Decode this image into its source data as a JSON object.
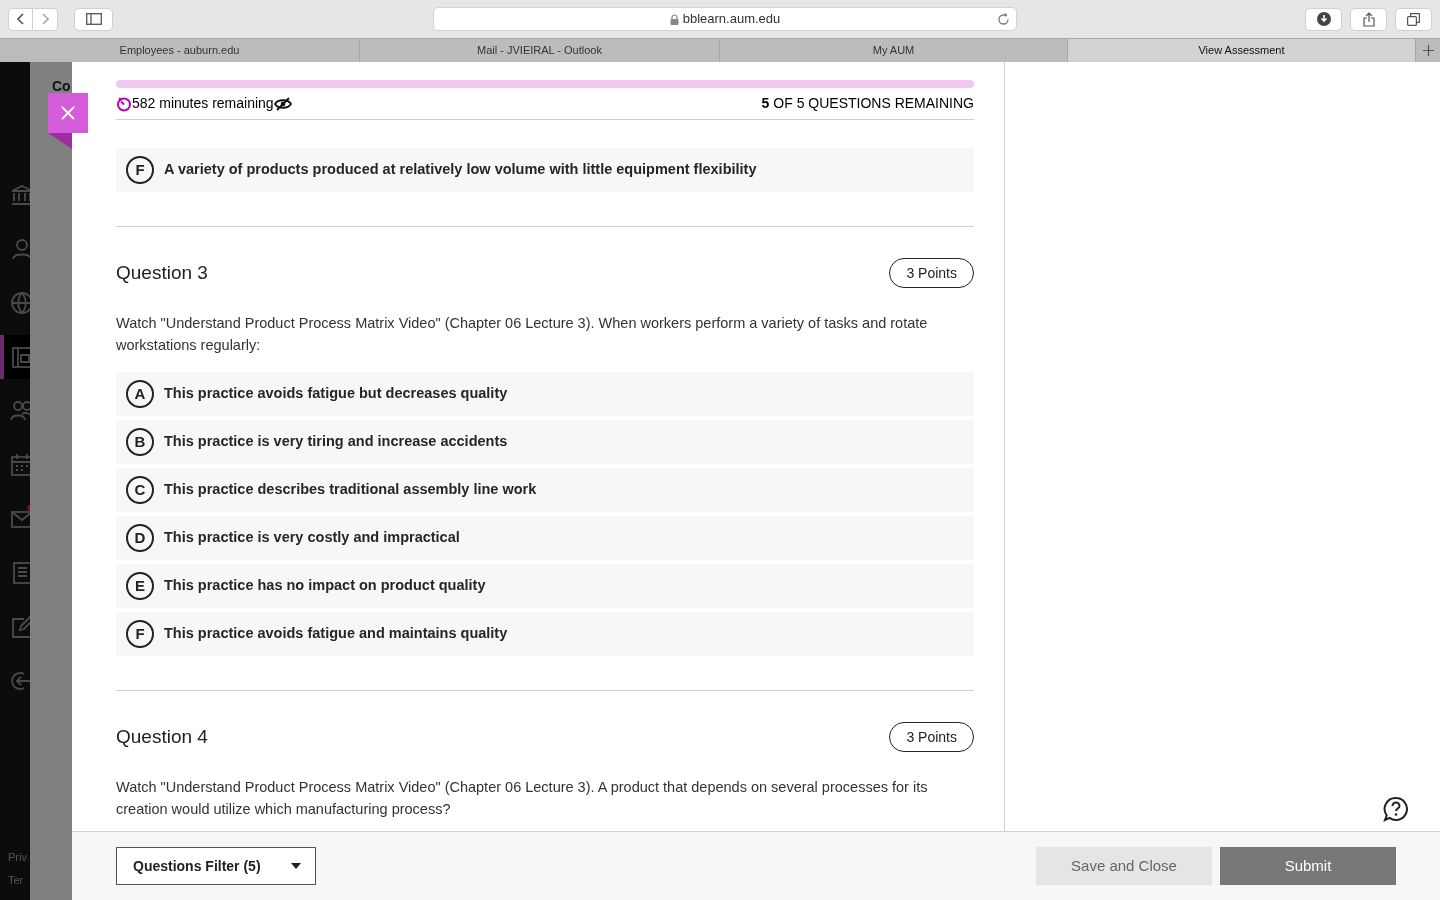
{
  "browser": {
    "url": "bblearn.aum.edu",
    "tabs": [
      {
        "label": "Employees - auburn.edu",
        "selected": false
      },
      {
        "label": "Mail - JVIEIRAL - Outlook",
        "selected": false
      },
      {
        "label": "My AUM",
        "selected": false
      },
      {
        "label": "View Assessment",
        "selected": true
      }
    ]
  },
  "background": {
    "course_fragment": "Co",
    "footer_fragments": [
      "Priv",
      "Ter"
    ]
  },
  "sidebar": {
    "items": [
      {
        "kind": "institution",
        "selected": false,
        "unread": false
      },
      {
        "kind": "profile",
        "selected": false,
        "unread": false
      },
      {
        "kind": "globe",
        "selected": false,
        "unread": false
      },
      {
        "kind": "courses",
        "selected": true,
        "unread": false
      },
      {
        "kind": "people",
        "selected": false,
        "unread": false
      },
      {
        "kind": "calendar",
        "selected": false,
        "unread": false
      },
      {
        "kind": "messages",
        "selected": false,
        "unread": true
      },
      {
        "kind": "grades",
        "selected": false,
        "unread": false
      },
      {
        "kind": "tools",
        "selected": false,
        "unread": false
      },
      {
        "kind": "signout",
        "selected": false,
        "unread": false
      }
    ]
  },
  "timer": {
    "text": "582 minutes remaining"
  },
  "questions_remaining": "**5** OF 5 QUESTIONS REMAINING",
  "questions": [
    {
      "options": [
        {
          "letter": "F",
          "text": "A variety of products produced at relatively low volume with little equipment flexibility"
        }
      ]
    },
    {
      "title": "Question 3",
      "points": "3 Points",
      "prompt": "Watch \"Understand Product Process Matrix Video\" (Chapter 06 Lecture 3). When workers perform a variety of tasks and rotate workstations regularly:",
      "options": [
        {
          "letter": "A",
          "text": "This practice avoids fatigue but decreases quality"
        },
        {
          "letter": "B",
          "text": "This practice is very tiring and increase accidents"
        },
        {
          "letter": "C",
          "text": "This practice describes traditional assembly line work"
        },
        {
          "letter": "D",
          "text": "This practice is very costly and impractical"
        },
        {
          "letter": "E",
          "text": "This practice has no impact on product quality"
        },
        {
          "letter": "F",
          "text": "This practice avoids fatigue and maintains quality"
        }
      ]
    },
    {
      "title": "Question 4",
      "points": "3 Points",
      "prompt": "Watch \"Understand Product Process Matrix Video\" (Chapter 06 Lecture 3). A product that depends on several processes for its creation would utilize which manufacturing process?"
    }
  ],
  "footer": {
    "filter": "Questions Filter (5)",
    "save_button": "Save and Close",
    "submit_button": "Submit"
  }
}
